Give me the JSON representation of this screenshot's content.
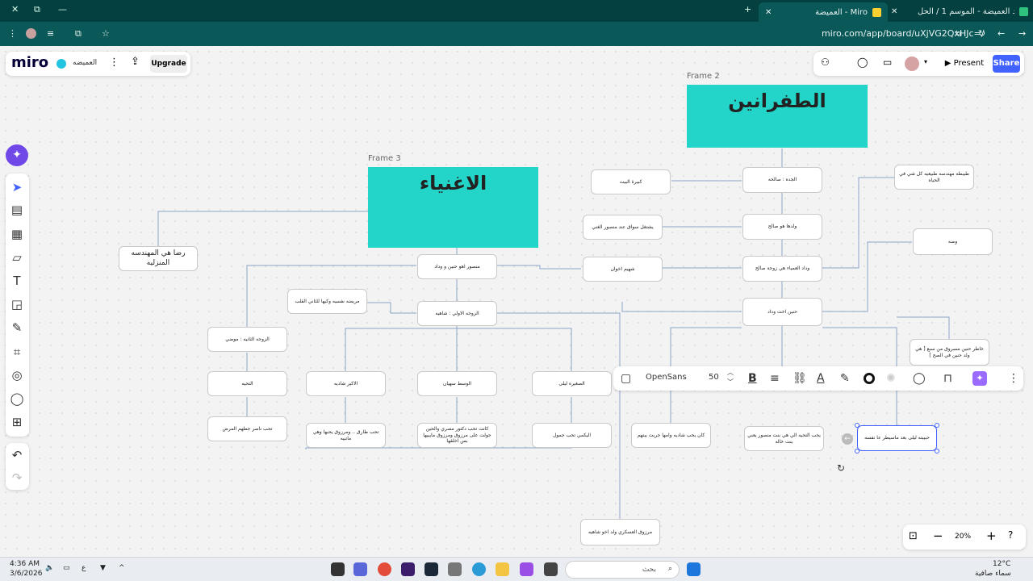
{
  "browser": {
    "tabs": [
      {
        "label": "شاهد العميضة - الموسم 1 / الحل..."
      },
      {
        "label": "العميضة - Miro"
      }
    ],
    "url": "miro.com/app/board/uXjVG2QxHJc=/"
  },
  "miro": {
    "logo": "miro",
    "board_name": "العميضه",
    "upgrade_label": "Upgrade",
    "present_label": "Present",
    "share_label": "Share",
    "zoom_level": "20%"
  },
  "frames": {
    "frame2": {
      "label": "Frame 2",
      "title": "الطفرانين"
    },
    "frame3": {
      "label": "Frame 3",
      "title": "الاغنياء"
    }
  },
  "nodes": {
    "n_reda": "رضا هي المهندسه المنزليه",
    "n_mansour": "منصور اهو حنين و وداد",
    "n_morida": "مريضه نفسيه وكيها للثاني القلب",
    "n_first_wife": "الزوجه الاولي : شاهيه",
    "n_second_wife": "الزوجه الثانيه : موضي",
    "n_eldest": "الاكبر شاديه",
    "n_middle": "الوسط سهيان",
    "n_youngest": "الصغيره ليلى",
    "n_tahiya": "التحيه",
    "n_tahiya_love": "تحب ناصر جطهم المرض",
    "n_tareq": "تحب طارق .. ومرزوق يحبها وهي ماتبيه",
    "n_doctor": "كانت تحب دكتور مصري والحين حولت على مرزوق ومرزوق مايبيها بس اخلقها",
    "n_alyami": "اليكمي تحب جمول",
    "n_marzouq": "مرزوق العسكري ولد اخو شاهيه",
    "n_kabira": "كبيرة البيت",
    "n_grandma": "الجده : صالحه",
    "n_works_driver": "يشتغل سواق عند منصور الغني",
    "n_son_saleh": "ولدها هو صالح",
    "n_baby": "شهيم اخوان",
    "n_wedad": "وداد العمياء هي زوجة صالح",
    "n_hanin": "حنين اخت وداد",
    "n_engineer": "طيبطه مهندسه طبيعيه كل شي في الحياه",
    "n_wadha": "وضه",
    "n_danger": "خاطر حنين مسروق من سبع [ هي ولد حنين في الصح ]",
    "n_kan": "كان يحب شاديه وامها جربت يبتهم",
    "n_loves_tahiya": "يحب التحيه الي هي بنت منصور يعني بنت خاله",
    "n_selected": "حبيبته ليلى بعد ماسيطر عا نفسه"
  },
  "toolbar": {
    "font": "OpenSans",
    "size": "50"
  },
  "taskbar": {
    "time": "4:36 AM",
    "date": "3/6/2026",
    "search": "بحث",
    "weather_temp": "12°C",
    "weather_desc": "سماء صافية",
    "lang": "ع"
  }
}
